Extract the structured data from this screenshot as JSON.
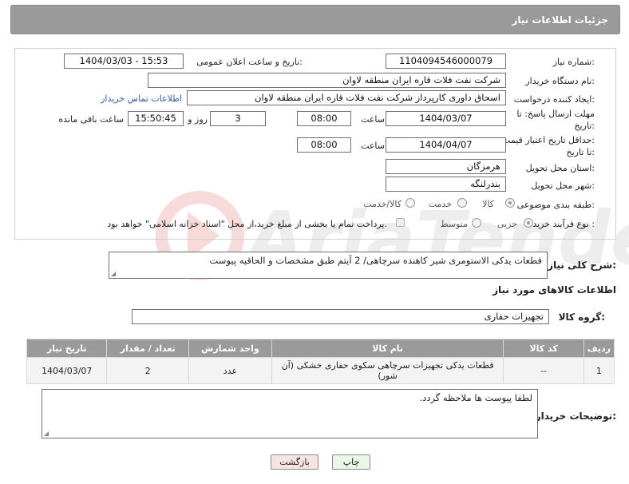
{
  "header": {
    "title": "جزئیات اطلاعات نیاز"
  },
  "fields": {
    "need_number_label": "شماره نیاز:",
    "need_number": "1104094546000079",
    "announce_label": "تاریخ و ساعت اعلان عمومی:",
    "announce_value": "1404/03/03 - 15:53",
    "buyer_org_label": "نام دستگاه خریدار:",
    "buyer_org": "شرکت نفت فلات قاره ایران منطقه لاوان",
    "requester_label": "ایجاد کننده درخواست:",
    "requester": "اسحاق داوری کارپرداز شرکت نفت فلات قاره ایران منطقه لاوان",
    "contact_link": "اطلاعات تماس خریدار",
    "reply_deadline_label_1": "مهلت ارسال پاسخ: تا",
    "reply_deadline_label_2": "تاریخ:",
    "reply_date": "1404/03/07",
    "time_label": "ساعت",
    "reply_time": "08:00",
    "days_value": "3",
    "days_label": "روز و",
    "remaining_time": "15:50:45",
    "remaining_label": "ساعت باقی مانده",
    "price_validity_label_1": "حداقل تاریخ اعتبار قیمت:",
    "price_validity_label_2": "تا تاریخ:",
    "price_date": "1404/04/07",
    "price_time": "08:00",
    "province_label": "استان محل تحویل:",
    "province": "هرمزگان",
    "city_label": "شهر محل تحویل:",
    "city": "بندرلنگه",
    "category_label": "طبقه بندی موضوعی:",
    "category_options": [
      "کالا",
      "خدمت",
      "کالا/خدمت"
    ],
    "category_selected": "کالا",
    "process_label": "نوع فرآیند خرید :",
    "process_options": [
      "جزیی",
      "متوسط"
    ],
    "process_selected": "جزیی",
    "payment_note": "پرداخت تمام یا بخشی از مبلغ خرید،از محل \"اسناد خزانه اسلامی\" خواهد بود."
  },
  "description": {
    "label": "شرح کلی نیاز:",
    "text": "قطعات یدکی الاستومری شیر کاهنده سرچاهی/ 2 آیتم طبق مشخصات و الحاقیه پیوست"
  },
  "goods": {
    "section_title": "اطلاعات کالاهای مورد نیاز",
    "group_label": "گروه کالا:",
    "group_value": "تجهیزات حفاری"
  },
  "table": {
    "headers": {
      "row": "ردیف",
      "code": "کد کالا",
      "name": "نام کالا",
      "unit": "واحد شمارش",
      "qty": "تعداد / مقدار",
      "date": "تاریخ نیاز"
    },
    "rows": [
      {
        "row": "1",
        "code": "--",
        "name": "قطعات یدکی تجهیزات سرچاهی سکوی حفاری خشکی (آن شور)",
        "unit": "عدد",
        "qty": "2",
        "date": "1404/03/07"
      }
    ]
  },
  "buyer_notes": {
    "label": "توضیحات خریدار:",
    "text": "لطفا پیوست ها ملاحظه گردد."
  },
  "buttons": {
    "print": "چاپ",
    "back": "بازگشت"
  },
  "colors": {
    "header_bg": "#9a9a9a",
    "link": "#2a5db0",
    "print_btn": "#e9f8e6",
    "back_btn": "#f6e3e3"
  },
  "watermark": "AriaTender.net"
}
